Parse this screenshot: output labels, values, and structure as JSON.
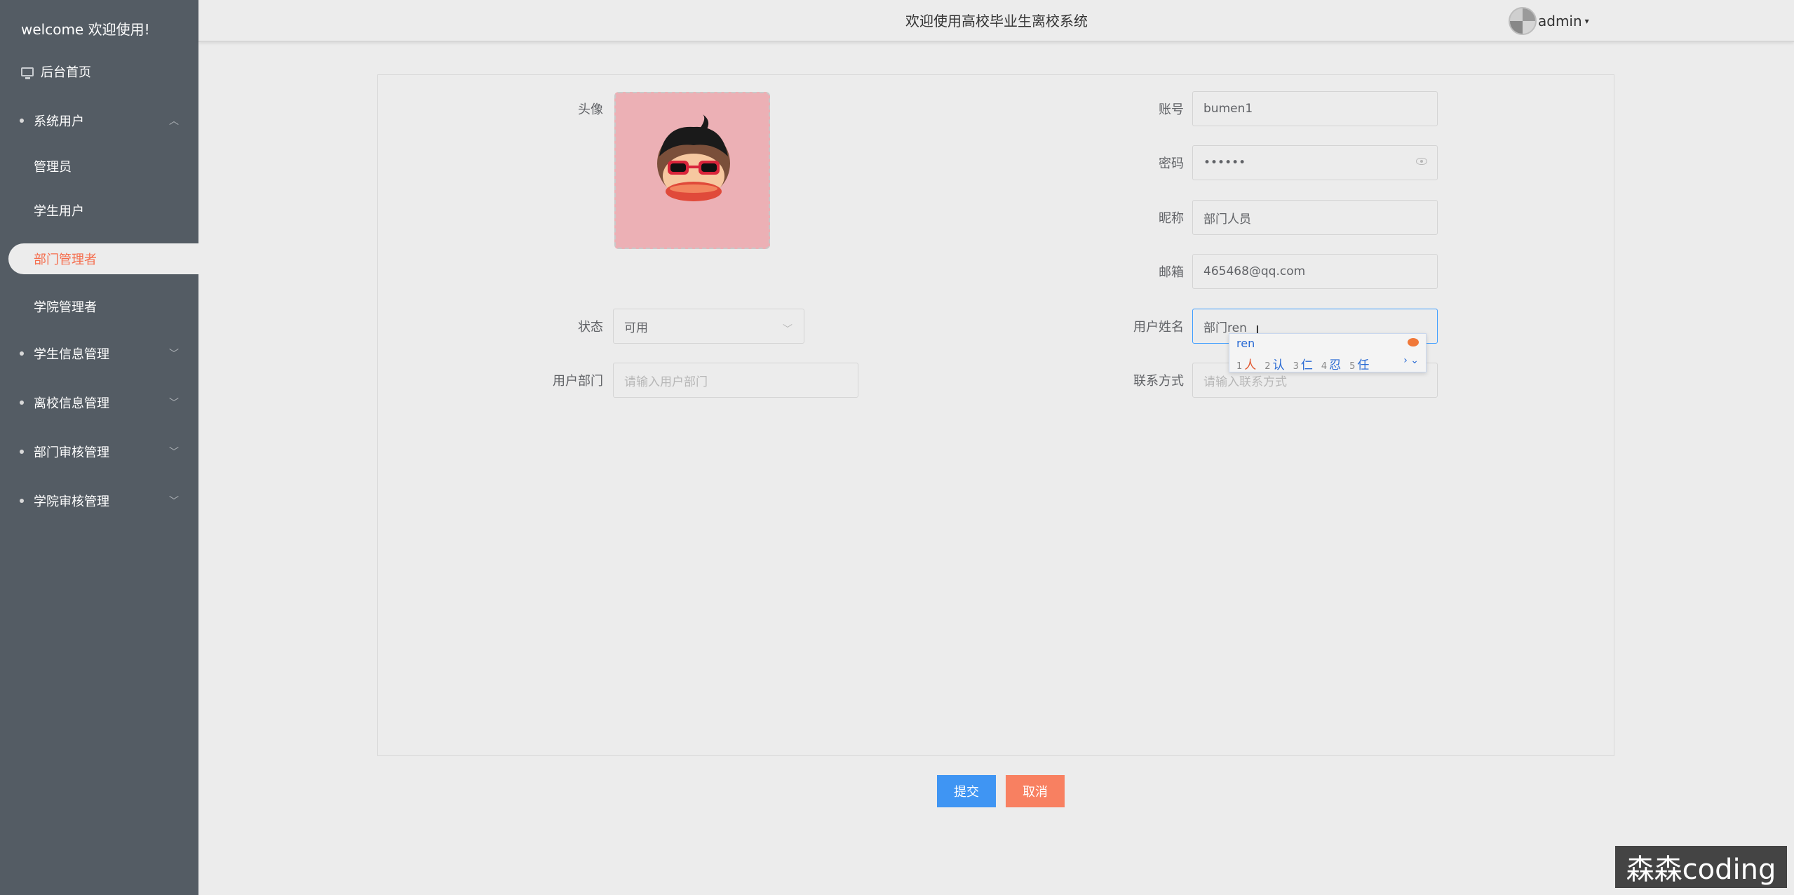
{
  "sidebar": {
    "welcome": "welcome 欢迎使用!",
    "home": "后台首页",
    "system_users": "系统用户",
    "admin": "管理员",
    "student_users": "学生用户",
    "dept_manager": "部门管理者",
    "college_manager": "学院管理者",
    "student_info": "学生信息管理",
    "leaving_info": "离校信息管理",
    "dept_review": "部门审核管理",
    "college_review": "学院审核管理"
  },
  "header": {
    "title": "欢迎使用高校毕业生离校系统",
    "user": "admin"
  },
  "form": {
    "avatar_label": "头像",
    "account_label": "账号",
    "account_value": "bumen1",
    "password_label": "密码",
    "password_value": "••••••",
    "nickname_label": "昵称",
    "nickname_value": "部门人员",
    "email_label": "邮箱",
    "email_value": "465468@qq.com",
    "status_label": "状态",
    "status_value": "可用",
    "name_label": "用户姓名",
    "name_value": "部门ren",
    "dept_label": "用户部门",
    "dept_placeholder": "请输入用户部门",
    "contact_label": "联系方式",
    "contact_placeholder": "请输入联系方式"
  },
  "ime": {
    "pinyin": "ren",
    "candidates": [
      {
        "n": "1",
        "c": "人"
      },
      {
        "n": "2",
        "c": "认"
      },
      {
        "n": "3",
        "c": "仁"
      },
      {
        "n": "4",
        "c": "忍"
      },
      {
        "n": "5",
        "c": "任"
      }
    ]
  },
  "buttons": {
    "submit": "提交",
    "cancel": "取消"
  },
  "watermark": "森森coding",
  "colors": {
    "sidebar_bg": "#545c64",
    "active_text": "#f56c4b",
    "submit": "#3f95f3",
    "cancel": "#f88061"
  }
}
